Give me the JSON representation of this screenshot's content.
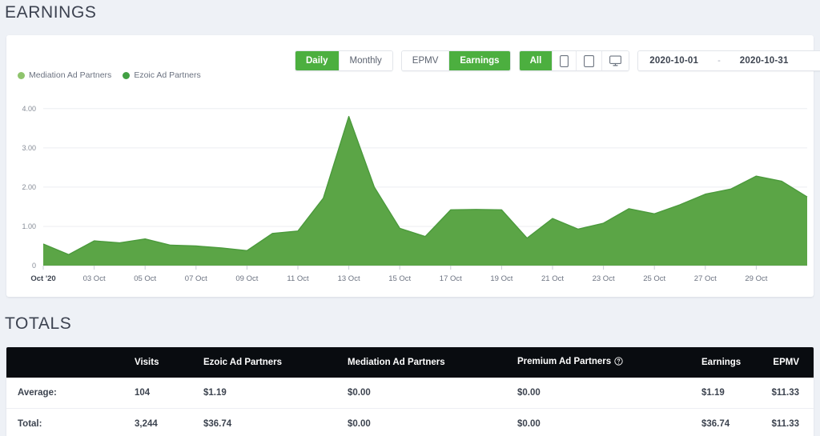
{
  "headings": {
    "earnings": "EARNINGS",
    "totals": "TOTALS"
  },
  "toolbar": {
    "interval": {
      "options": [
        "Daily",
        "Monthly"
      ],
      "selected": "Daily"
    },
    "metric": {
      "options": [
        "EPMV",
        "Earnings"
      ],
      "selected": "Earnings"
    },
    "device": {
      "options": [
        "All",
        "mobile-icon",
        "tablet-icon",
        "desktop-icon"
      ],
      "selected": "All"
    },
    "labels": {
      "daily": "Daily",
      "monthly": "Monthly",
      "epmv": "EPMV",
      "earnings": "Earnings",
      "all": "All"
    },
    "date_range": {
      "start": "2020-10-01",
      "separator": "-",
      "end": "2020-10-31",
      "icon": "calendar-icon"
    }
  },
  "legend": [
    {
      "label": "Mediation Ad Partners",
      "color": "#8fc46d"
    },
    {
      "label": "Ezoic Ad Partners",
      "color": "#41a043"
    }
  ],
  "colors": {
    "accent_green": "#4caf3f",
    "chart_fill": "#5ba546",
    "chart_line": "#4b9a3c",
    "page_bg": "#eef1f6",
    "table_header_bg": "#090c10"
  },
  "chart_data": {
    "type": "area",
    "title": "EARNINGS",
    "xlabel": "",
    "ylabel": "",
    "ylim": [
      0,
      4.2
    ],
    "yticks": [
      "0",
      "1.00",
      "2.00",
      "3.00",
      "4.00"
    ],
    "ytick_values": [
      0,
      1,
      2,
      3,
      4
    ],
    "grid": true,
    "legend_position": "top-left",
    "xtick_labels": [
      "Oct '20",
      "03 Oct",
      "05 Oct",
      "07 Oct",
      "09 Oct",
      "11 Oct",
      "13 Oct",
      "15 Oct",
      "17 Oct",
      "19 Oct",
      "21 Oct",
      "23 Oct",
      "25 Oct",
      "27 Oct",
      "29 Oct"
    ],
    "x": [
      "01 Oct",
      "02 Oct",
      "03 Oct",
      "04 Oct",
      "05 Oct",
      "06 Oct",
      "07 Oct",
      "08 Oct",
      "09 Oct",
      "10 Oct",
      "11 Oct",
      "12 Oct",
      "13 Oct",
      "14 Oct",
      "15 Oct",
      "16 Oct",
      "17 Oct",
      "18 Oct",
      "19 Oct",
      "20 Oct",
      "21 Oct",
      "22 Oct",
      "23 Oct",
      "24 Oct",
      "25 Oct",
      "26 Oct",
      "27 Oct",
      "28 Oct",
      "29 Oct",
      "30 Oct",
      "31 Oct"
    ],
    "series": [
      {
        "name": "Ezoic Ad Partners",
        "color": "#5ba546",
        "values": [
          0.55,
          0.28,
          0.63,
          0.58,
          0.68,
          0.52,
          0.5,
          0.45,
          0.38,
          0.82,
          0.88,
          1.72,
          3.8,
          2.0,
          0.95,
          0.74,
          1.42,
          1.43,
          1.42,
          0.7,
          1.2,
          0.93,
          1.08,
          1.45,
          1.32,
          1.55,
          1.82,
          1.95,
          2.28,
          2.15,
          1.75
        ]
      },
      {
        "name": "Mediation Ad Partners",
        "color": "#8fc46d",
        "values": [
          0,
          0,
          0,
          0,
          0,
          0,
          0,
          0,
          0,
          0,
          0,
          0,
          0,
          0,
          0,
          0,
          0,
          0,
          0,
          0,
          0,
          0,
          0,
          0,
          0,
          0,
          0,
          0,
          0,
          0,
          0
        ]
      }
    ]
  },
  "totals_table": {
    "columns": [
      {
        "key": "label",
        "label": ""
      },
      {
        "key": "visits",
        "label": "Visits"
      },
      {
        "key": "ezoic",
        "label": "Ezoic Ad Partners"
      },
      {
        "key": "mediation",
        "label": "Mediation Ad Partners"
      },
      {
        "key": "premium",
        "label": "Premium Ad Partners",
        "icon": "help-icon"
      },
      {
        "key": "earnings",
        "label": "Earnings"
      },
      {
        "key": "epmv",
        "label": "EPMV"
      }
    ],
    "rows": [
      {
        "label": "Average:",
        "visits": "104",
        "ezoic": "$1.19",
        "mediation": "$0.00",
        "premium": "$0.00",
        "earnings": "$1.19",
        "epmv": "$11.33"
      },
      {
        "label": "Total:",
        "visits": "3,244",
        "ezoic": "$36.74",
        "mediation": "$0.00",
        "premium": "$0.00",
        "earnings": "$36.74",
        "epmv": "$11.33"
      }
    ]
  }
}
